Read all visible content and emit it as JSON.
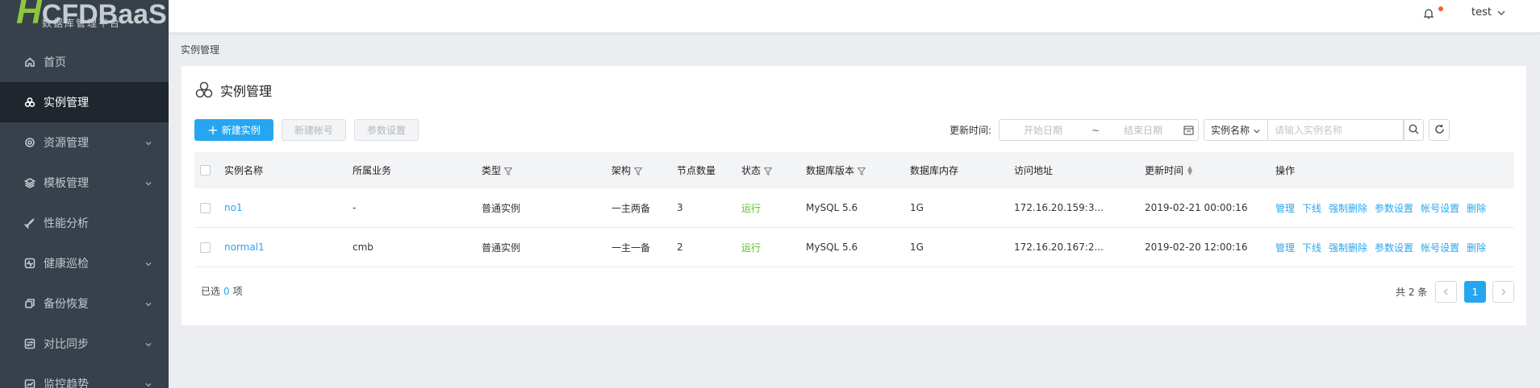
{
  "logo": {
    "main": "HCFDBaaS",
    "subtitle": "数据库管理平台"
  },
  "sidebar": {
    "items": [
      {
        "label": "首页",
        "icon": "home-icon",
        "active": false,
        "expandable": false
      },
      {
        "label": "实例管理",
        "icon": "instances-icon",
        "active": true,
        "expandable": false
      },
      {
        "label": "资源管理",
        "icon": "resource-icon",
        "active": false,
        "expandable": true
      },
      {
        "label": "模板管理",
        "icon": "layers-icon",
        "active": false,
        "expandable": true
      },
      {
        "label": "性能分析",
        "icon": "rocket-icon",
        "active": false,
        "expandable": false
      },
      {
        "label": "健康巡检",
        "icon": "pulse-icon",
        "active": false,
        "expandable": true
      },
      {
        "label": "备份恢复",
        "icon": "copy-icon",
        "active": false,
        "expandable": true
      },
      {
        "label": "对比同步",
        "icon": "compare-icon",
        "active": false,
        "expandable": true
      },
      {
        "label": "监控趋势",
        "icon": "chart-icon",
        "active": false,
        "expandable": true
      }
    ]
  },
  "header": {
    "username": "test",
    "notification_dot_color": "#f5602b"
  },
  "breadcrumb": "实例管理",
  "page_title": "实例管理",
  "toolbar": {
    "new_instance": "新建实例",
    "new_account": "新建帐号",
    "param_settings": "参数设置",
    "update_time_label": "更新时间:",
    "start_date_placeholder": "开始日期",
    "date_separator": "~",
    "end_date_placeholder": "结束日期",
    "search_field": "实例名称",
    "search_placeholder": "请输入实例名称"
  },
  "table": {
    "columns": [
      "实例名称",
      "所属业务",
      "类型",
      "架构",
      "节点数量",
      "状态",
      "数据库版本",
      "数据库内存",
      "访问地址",
      "更新时间",
      "操作"
    ],
    "rows": [
      {
        "name": "no1",
        "business": "-",
        "type": "普通实例",
        "arch": "一主两备",
        "nodes": "3",
        "status": "运行",
        "version": "MySQL 5.6",
        "memory": "1G",
        "address": "172.16.20.159:3...",
        "updated": "2019-02-21 00:00:16",
        "ops": [
          "管理",
          "下线",
          "强制删除",
          "参数设置",
          "帐号设置",
          "删除"
        ]
      },
      {
        "name": "normal1",
        "business": "cmb",
        "type": "普通实例",
        "arch": "一主一备",
        "nodes": "2",
        "status": "运行",
        "version": "MySQL 5.6",
        "memory": "1G",
        "address": "172.16.20.167:2...",
        "updated": "2019-02-20 12:00:16",
        "ops": [
          "管理",
          "下线",
          "强制删除",
          "参数设置",
          "帐号设置",
          "删除"
        ]
      }
    ]
  },
  "footer": {
    "selected_prefix": "已选",
    "selected_count": "0",
    "selected_suffix": "项",
    "total": "共 2 条",
    "current_page": "1"
  },
  "colors": {
    "accent": "#27a6f0",
    "sidebar_bg": "#37414b",
    "status_ok": "#52c41a"
  }
}
